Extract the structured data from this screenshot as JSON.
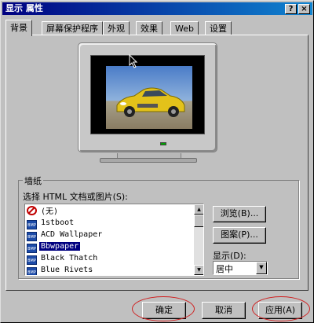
{
  "window": {
    "title": "显示 属性",
    "help_glyph": "?",
    "close_glyph": "×"
  },
  "tabs": [
    {
      "label": "背景",
      "active": true
    },
    {
      "label": "屏幕保护程序",
      "active": false
    },
    {
      "label": "外观",
      "active": false
    },
    {
      "label": "效果",
      "active": false
    },
    {
      "label": "Web",
      "active": false
    },
    {
      "label": "设置",
      "active": false
    }
  ],
  "wallpaper": {
    "group_label": "墙纸",
    "choose_label": "选择 HTML 文档或图片(S):",
    "items": [
      {
        "label": "(无)",
        "icon": "none-icon",
        "selected": false
      },
      {
        "label": "1stboot",
        "icon": "bmp-file-icon",
        "selected": false
      },
      {
        "label": "ACD Wallpaper",
        "icon": "bmp-file-icon",
        "selected": false
      },
      {
        "label": "Bbwpaper",
        "icon": "bmp-file-icon",
        "selected": true
      },
      {
        "label": "Black Thatch",
        "icon": "bmp-file-icon",
        "selected": false
      },
      {
        "label": "Blue Rivets",
        "icon": "bmp-file-icon",
        "selected": false
      }
    ],
    "bmp_icon_text": "BMP",
    "browse_label": "浏览(B)...",
    "pattern_label": "图案(P)...",
    "display_label": "显示(D):",
    "display_value": "居中"
  },
  "footer": {
    "ok_label": "确定",
    "cancel_label": "取消",
    "apply_label": "应用(A)"
  },
  "colors": {
    "titlebar": "#000080",
    "selection": "#000080",
    "highlight_oval": "#d02020"
  }
}
